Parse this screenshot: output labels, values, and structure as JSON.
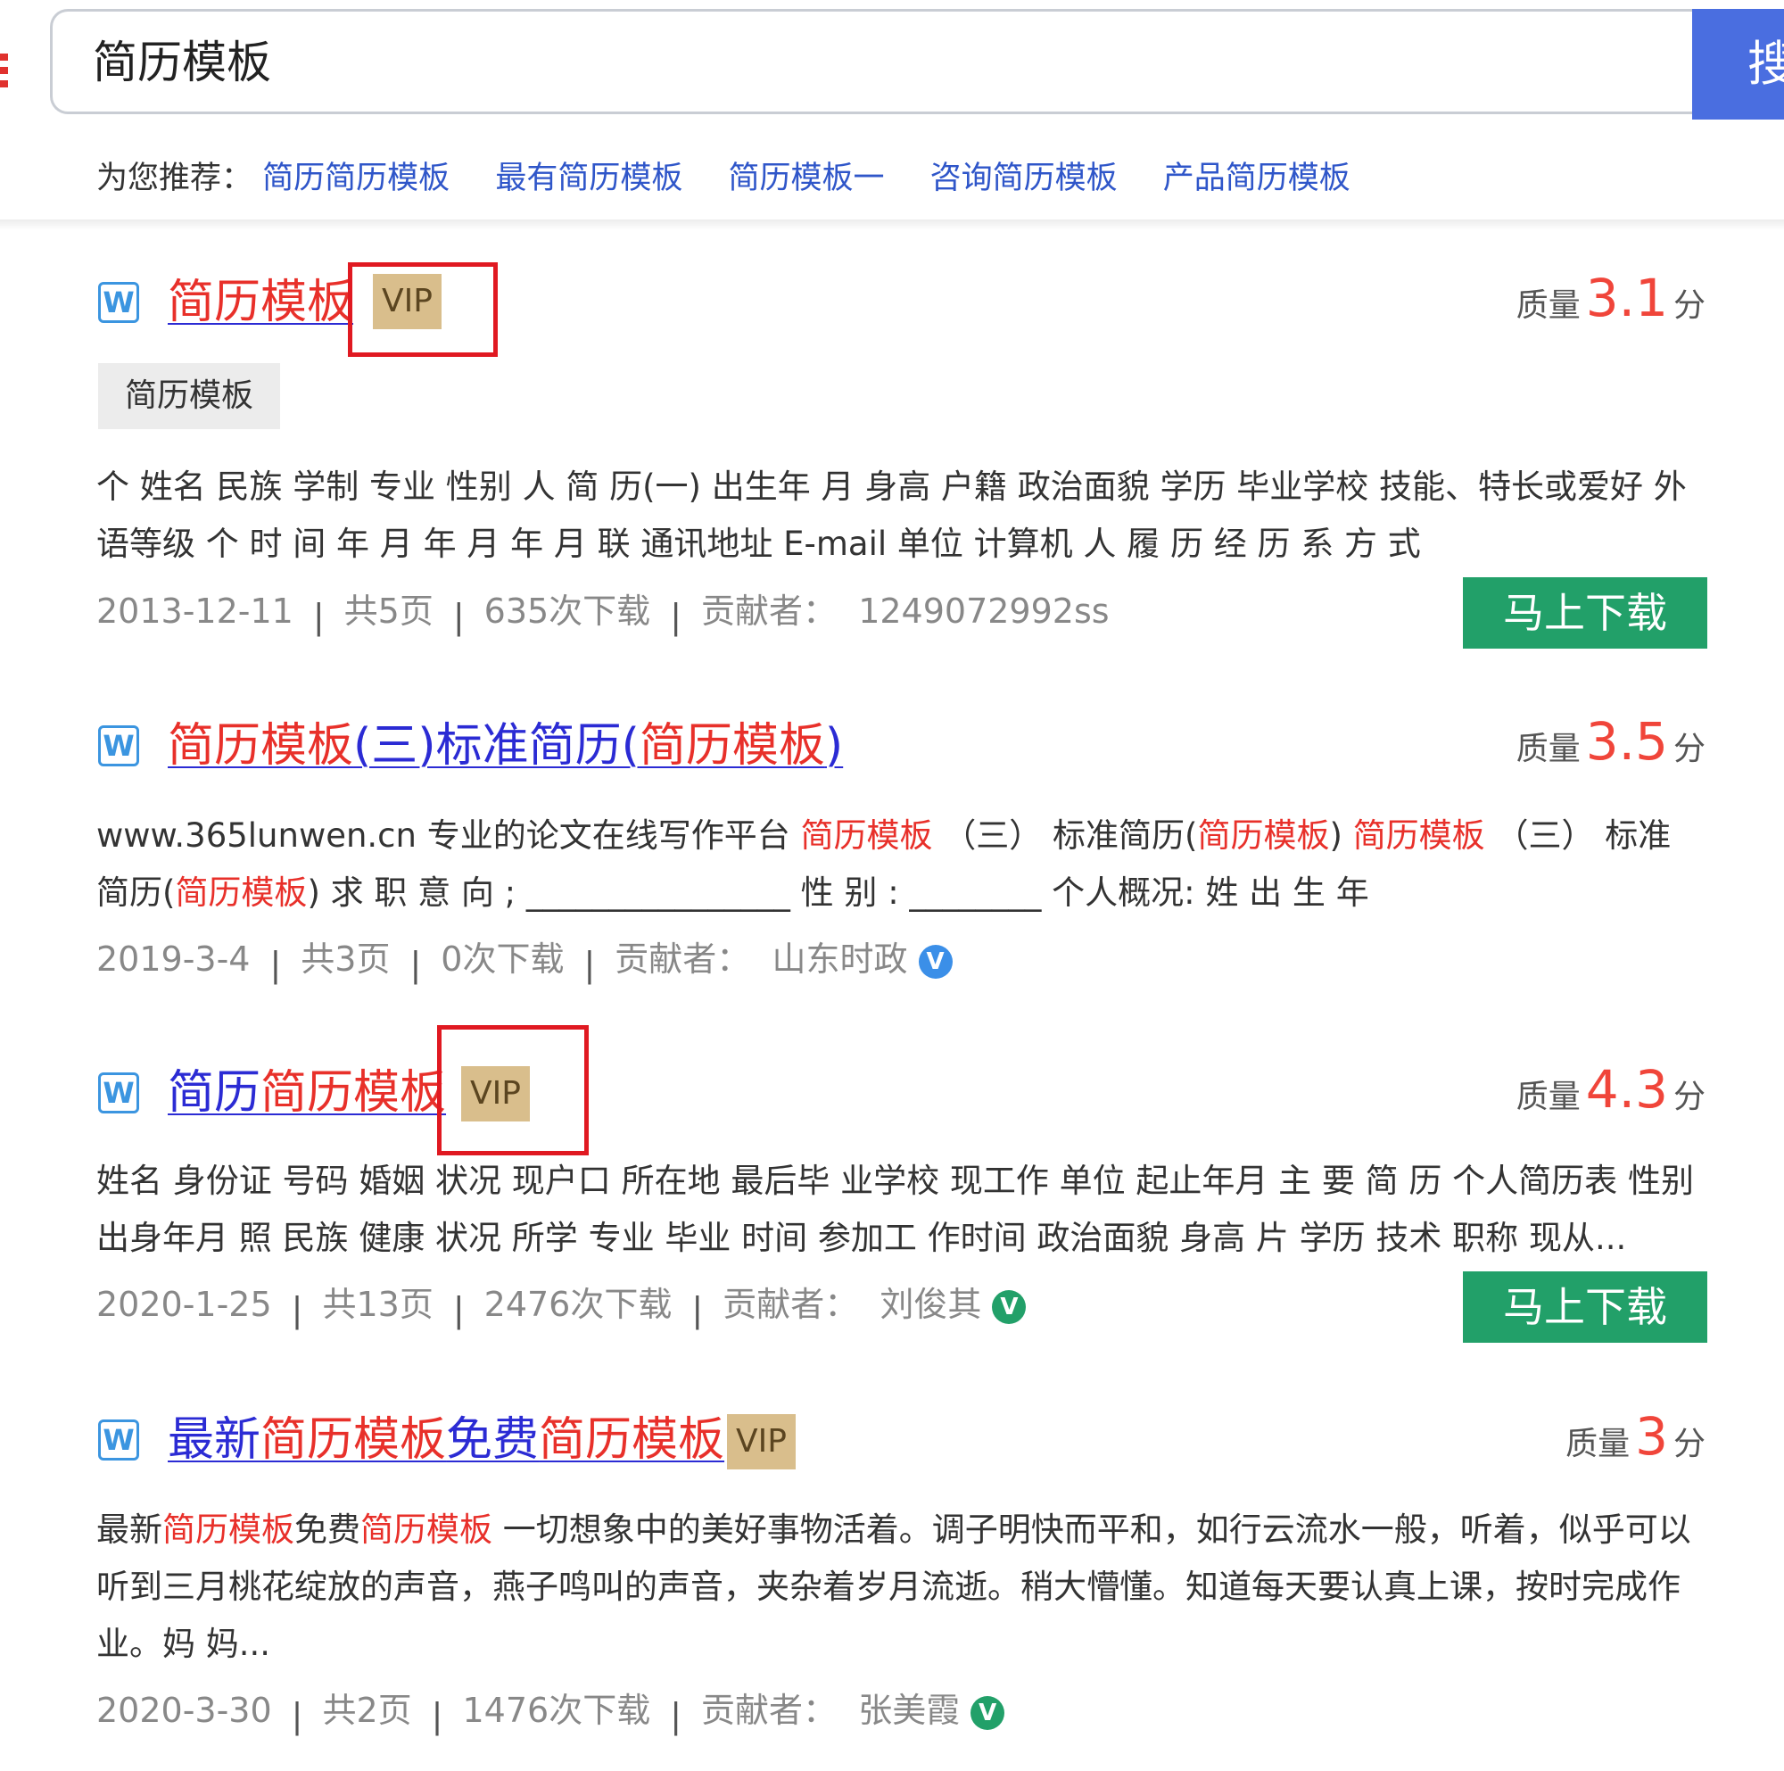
{
  "search": {
    "query": "简历模板",
    "button_label": "搜"
  },
  "recommend": {
    "label": "为您推荐：",
    "links": [
      "简历简历模板",
      "最有简历模板",
      "简历模板一",
      "咨询简历模板",
      "产品简历模板"
    ]
  },
  "icons": {
    "doc_icon": "word-doc-icon",
    "doc_icon_glyph": "W",
    "verified_glyph": "V"
  },
  "results": [
    {
      "title": [
        {
          "t": "简历模板",
          "hl": true
        }
      ],
      "vip": "VIP",
      "quality_label": "质量",
      "score": "3.1",
      "score_unit": "分",
      "tag": "简历模板",
      "desc": [
        {
          "t": "个 姓名 民族 学制 专业 性别 人 简 历(一) 出生年 月 身高 户籍 政治面貌 学历 毕业学校 技能、特长或爱好 外语等级 个 时 间 年 月 年 月 年 月 联 通讯地址 E-mail 单位 计算机 人 履 历 经 历 系 方 式",
          "hl": false
        }
      ],
      "date": "2013-12-11",
      "pages": "共5页",
      "downloads": "635次下载",
      "contributor_label": "贡献者：",
      "contributor": "1249072992ss",
      "download_label": "马上下载"
    },
    {
      "title": [
        {
          "t": "简历模板",
          "hl": true
        },
        {
          "t": "(三)标准简历(",
          "hl": false
        },
        {
          "t": "简历模板",
          "hl": true
        },
        {
          "t": ")",
          "hl": false
        }
      ],
      "quality_label": "质量",
      "score": "3.5",
      "score_unit": "分",
      "desc": [
        {
          "t": "www.365lunwen.cn 专业的论文在线写作平台 ",
          "hl": false
        },
        {
          "t": "简历模板",
          "hl": true
        },
        {
          "t": " （三） 标准简历(",
          "hl": false
        },
        {
          "t": "简历模板",
          "hl": true
        },
        {
          "t": ") ",
          "hl": false
        },
        {
          "t": "简历模板",
          "hl": true
        },
        {
          "t": " （三） 标准简历(",
          "hl": false
        },
        {
          "t": "简历模板",
          "hl": true
        },
        {
          "t": ") 求 职 意 向 ; ________________ 性 别 : ________ 个人概况: 姓 出 生 年",
          "hl": false
        }
      ],
      "date": "2019-3-4",
      "pages": "共3页",
      "downloads": "0次下载",
      "contributor_label": "贡献者：",
      "contributor": "山东时政",
      "verified_color": "#3b8fe8"
    },
    {
      "title": [
        {
          "t": "简历",
          "hl": false
        },
        {
          "t": "简历模板",
          "hl": true
        }
      ],
      "vip": "VIP",
      "quality_label": "质量",
      "score": "4.3",
      "score_unit": "分",
      "desc": [
        {
          "t": "姓名 身份证 号码 婚姻 状况 现户口 所在地 最后毕 业学校 现工作 单位 起止年月 主 要 简 历 个人简历表 性别 出身年月 照 民族 健康 状况 所学 专业 毕业 时间 参加工 作时间 政治面貌 身高 片 学历 技术 职称 现从...",
          "hl": false
        }
      ],
      "date": "2020-1-25",
      "pages": "共13页",
      "downloads": "2476次下载",
      "contributor_label": "贡献者：",
      "contributor": "刘俊其",
      "verified_color": "#22a069",
      "download_label": "马上下载"
    },
    {
      "title": [
        {
          "t": "最新",
          "hl": false
        },
        {
          "t": "简历模板",
          "hl": true
        },
        {
          "t": "免费",
          "hl": false
        },
        {
          "t": "简历模板",
          "hl": true
        }
      ],
      "vip": "VIP",
      "quality_label": "质量",
      "score": "3",
      "score_unit": "分",
      "desc": [
        {
          "t": "最新",
          "hl": false
        },
        {
          "t": "简历模板",
          "hl": true
        },
        {
          "t": "免费",
          "hl": false
        },
        {
          "t": "简历模板",
          "hl": true
        },
        {
          "t": " 一切想象中的美好事物活着。调子明快而平和，如行云流水一般，听着，似乎可以听到三月桃花绽放的声音，燕子鸣叫的声音，夹杂着岁月流逝。稍大懵懂。知道每天要认真上课，按时完成作业。妈 妈...",
          "hl": false
        }
      ],
      "date": "2020-3-30",
      "pages": "共2页",
      "downloads": "1476次下载",
      "contributor_label": "贡献者：",
      "contributor": "张美霞",
      "verified_color": "#22a069"
    }
  ],
  "colors": {
    "highlight": "#e8302a",
    "link": "#2b2bd4",
    "search_button": "#4a6ee0",
    "download_button": "#22a069",
    "vip_badge": "#d9be8c",
    "annotation_frame": "#e01921"
  }
}
